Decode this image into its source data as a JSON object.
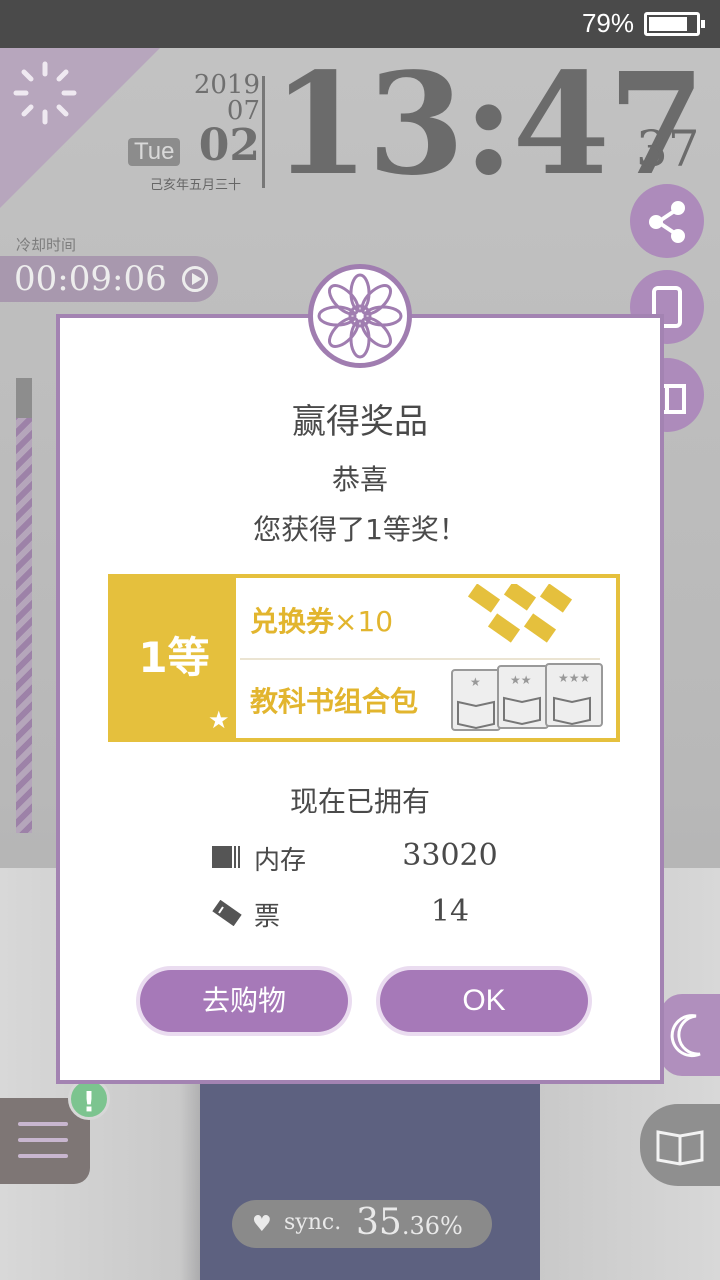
{
  "status_bar": {
    "battery_percent": "79%"
  },
  "clock": {
    "year": "2019",
    "month": "07",
    "day": "02",
    "weekday": "Tue",
    "lunar": "己亥年五月三十",
    "time": "13:47",
    "seconds": "37"
  },
  "cooldown": {
    "label": "冷却时间",
    "time": "00:09:06"
  },
  "dialog": {
    "title": "赢得奖品",
    "congrats": "恭喜",
    "message": "您获得了1等奖！",
    "prize": {
      "rank": "1等",
      "item1": "兑换券",
      "item1_qty": "×10",
      "item2": "教科书组合包"
    },
    "owned_title": "现在已拥有",
    "inventory": [
      {
        "label": "内存",
        "value": "33020"
      },
      {
        "label": "票",
        "value": "14"
      }
    ],
    "shop_button": "去购物",
    "ok_button": "OK"
  },
  "sync": {
    "label": "sync.",
    "value": "35",
    "decimal": ".36%"
  },
  "alert_badge": "!",
  "colors": {
    "accent_purple": "#a679b8",
    "prize_gold": "#e5c03d"
  }
}
